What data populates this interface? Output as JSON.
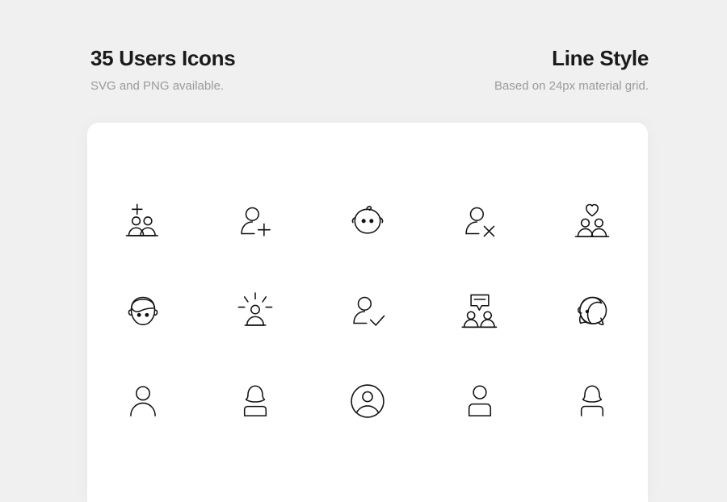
{
  "header": {
    "left": {
      "title": "35 Users Icons",
      "subtitle": "SVG and PNG available."
    },
    "right": {
      "title": "Line Style",
      "subtitle": "Based on 24px material grid."
    }
  },
  "colors": {
    "background": "#f0f0f0",
    "card": "#ffffff",
    "icon_stroke": "#121212",
    "title_text": "#1a1a1a",
    "subtitle_text": "#9b9b9b"
  },
  "icon_set": {
    "count_label": "35",
    "style": "Line Style",
    "grid_base": "24px material grid",
    "columns": 5,
    "rows": 3,
    "icons": [
      {
        "name": "add-group-icon",
        "label": "Add group"
      },
      {
        "name": "add-user-icon",
        "label": "Add user"
      },
      {
        "name": "baby-face-icon",
        "label": "Baby"
      },
      {
        "name": "remove-user-icon",
        "label": "Remove user"
      },
      {
        "name": "couple-heart-icon",
        "label": "Couple with heart"
      },
      {
        "name": "boy-face-icon",
        "label": "Boy face"
      },
      {
        "name": "user-shine-icon",
        "label": "Featured user"
      },
      {
        "name": "user-check-icon",
        "label": "Verified user"
      },
      {
        "name": "group-chat-icon",
        "label": "Group chat"
      },
      {
        "name": "girl-face-icon",
        "label": "Girl face"
      },
      {
        "name": "user-outline-icon",
        "label": "User"
      },
      {
        "name": "woman-user-icon",
        "label": "Woman user"
      },
      {
        "name": "user-circle-icon",
        "label": "User account"
      },
      {
        "name": "user-square-icon",
        "label": "User profile"
      },
      {
        "name": "woman-outline-icon",
        "label": "Woman profile"
      }
    ]
  }
}
